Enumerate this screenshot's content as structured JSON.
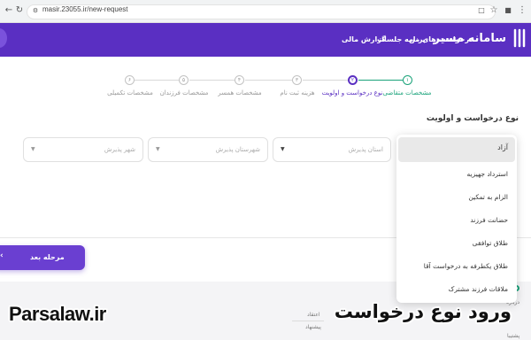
{
  "browser": {
    "url": "masir.23055.ir/new-request"
  },
  "nav": {
    "logo": "سامانه مسیر",
    "links": [
      "درخواست های من",
      "برنامه جلسات",
      "گزارش مالی"
    ]
  },
  "steps": [
    {
      "num": "۱",
      "label": "مشخصات متقاضی",
      "state": "done"
    },
    {
      "num": "۲",
      "label": "نوع درخواست و اولویت",
      "state": "active"
    },
    {
      "num": "۳",
      "label": "هزینه ثبت نام",
      "state": "pending"
    },
    {
      "num": "۴",
      "label": "مشخصات همسر",
      "state": "pending"
    },
    {
      "num": "۵",
      "label": "مشخصات فرزندان",
      "state": "pending"
    },
    {
      "num": "۶",
      "label": "مشخصات تکمیلی",
      "state": "pending"
    }
  ],
  "form": {
    "section_title": "نوع درخواست و اولویت",
    "province_placeholder": "استان پذیرش",
    "county_placeholder": "شهرستان پذیرش",
    "city_placeholder": "شهر پذیرش"
  },
  "dropdown": {
    "selected": "آزاد",
    "options": [
      "استرداد جهیزیه",
      "الزام به تمکین",
      "حضانت فرزند",
      "طلاق توافقی",
      "طلاق یکطرفه به درخواست آقا",
      "ملاقات فرزند مشترک"
    ]
  },
  "buttons": {
    "next": "مرحله بعد"
  },
  "bottom": {
    "labels": [
      "درباره",
      "اعتقاد",
      "پیشنهاد",
      "پشتیبا"
    ]
  },
  "watermark": {
    "left": "Parsalaw.ir",
    "right": "ورود نوع درخواست"
  },
  "colors": {
    "primary": "#5a2fc2",
    "success": "#1aa37a"
  }
}
